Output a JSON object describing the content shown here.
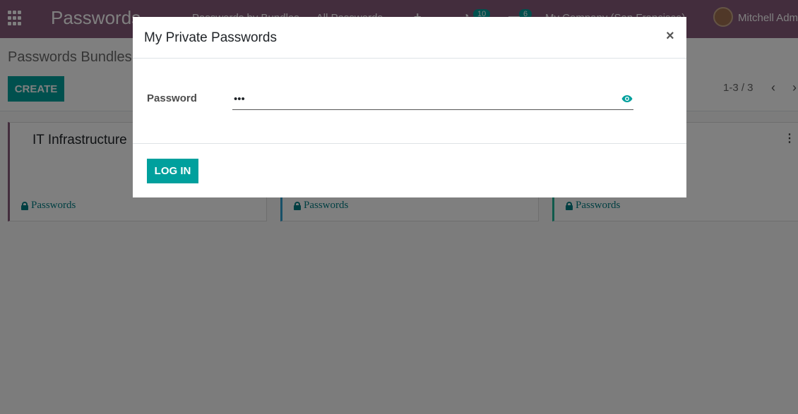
{
  "navbar": {
    "brand": "Passwords",
    "menu": [
      "Passwords by Bundles",
      "All Passwords"
    ],
    "plus": "+",
    "activity_count": "10",
    "messages_count": "6",
    "company": "My Company (San Francisco)",
    "user": "Mitchell Admin"
  },
  "control_panel": {
    "breadcrumb": "Passwords Bundles",
    "create_label": "CREATE",
    "pager": "1-3 / 3",
    "prev_icon": "chevron-left",
    "next_icon": "chevron-right"
  },
  "kanban": {
    "cards": [
      {
        "title": "IT Infrastructure",
        "footer": "Passwords",
        "accent": "#875a7b"
      },
      {
        "title": "",
        "footer": "Passwords",
        "accent": "#30a0d0"
      },
      {
        "title": "",
        "footer": "Passwords",
        "accent": "#21b799"
      }
    ]
  },
  "modal": {
    "title": "My Private Passwords",
    "close": "×",
    "field_label": "Password",
    "password_value": "•••",
    "login_label": "LOG IN"
  },
  "colors": {
    "navbar": "#875a7b",
    "primary": "#00a09d",
    "link": "#017e84"
  }
}
